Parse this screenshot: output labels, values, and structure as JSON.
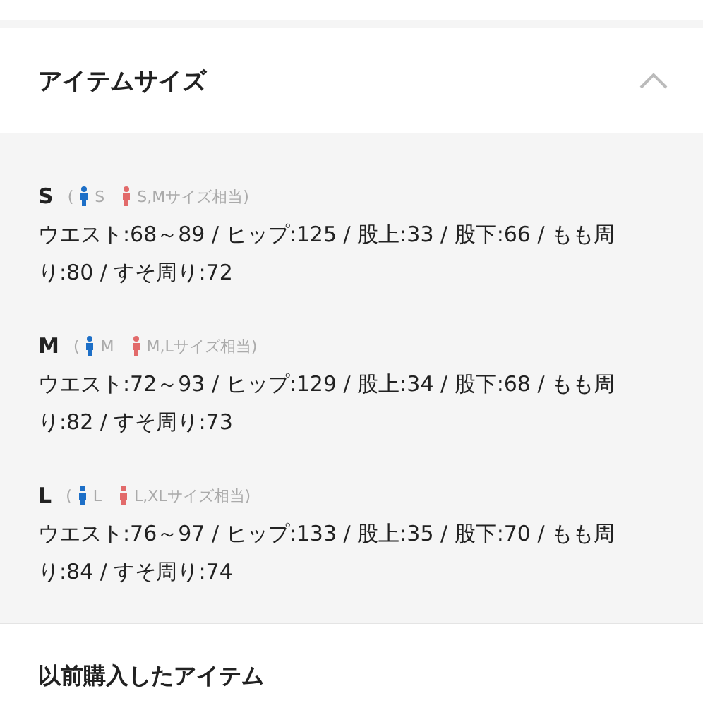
{
  "section": {
    "title": "アイテムサイズ",
    "expanded": true
  },
  "sizes": [
    {
      "label": "S",
      "open_paren": "(",
      "men": "S",
      "women": "S,Mサイズ相当)",
      "measurements": "ウエスト:68～89 / ヒップ:125 / 股上:33 / 股下:66 / もも周り:80 / すそ周り:72"
    },
    {
      "label": "M",
      "open_paren": "(",
      "men": "M",
      "women": "M,Lサイズ相当)",
      "measurements": "ウエスト:72～93 / ヒップ:129 / 股上:34 / 股下:68 / もも周り:82 / すそ周り:73"
    },
    {
      "label": "L",
      "open_paren": "(",
      "men": "L",
      "women": "L,XLサイズ相当)",
      "measurements": "ウエスト:76～97 / ヒップ:133 / 股上:35 / 股下:70 / もも周り:84 / すそ周り:74"
    }
  ],
  "next_section": {
    "title": "以前購入したアイテム"
  }
}
